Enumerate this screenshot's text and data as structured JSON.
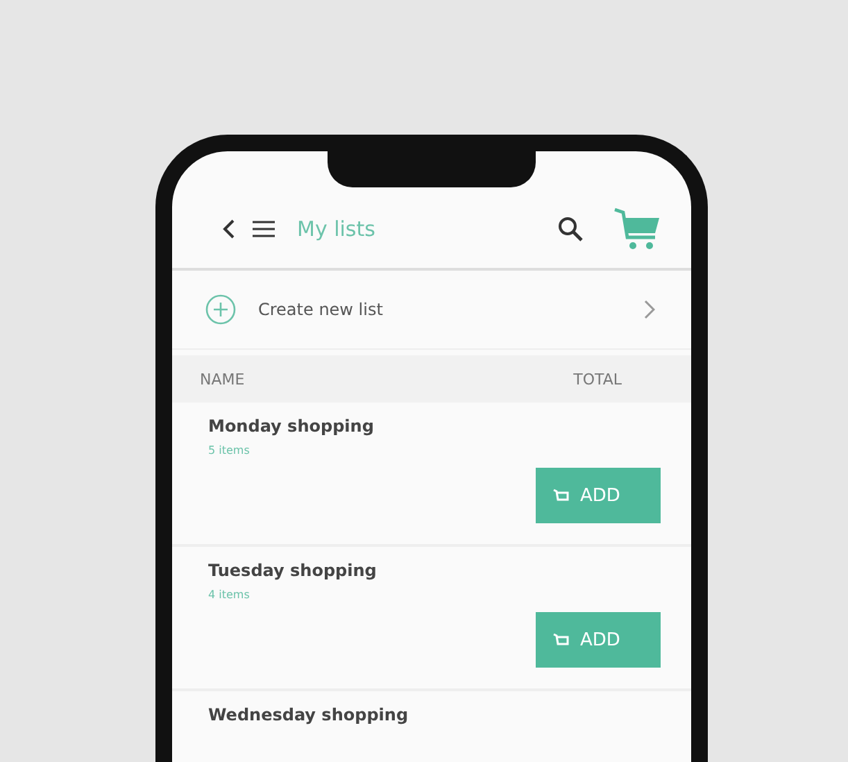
{
  "header": {
    "title": "My lists"
  },
  "create_row": {
    "label": "Create new list"
  },
  "table": {
    "columns": [
      "NAME",
      "TOTAL"
    ],
    "rows": [
      {
        "name": "Monday shopping",
        "count": "5 items",
        "button": "ADD"
      },
      {
        "name": "Tuesday shopping",
        "count": "4 items",
        "button": "ADD"
      },
      {
        "name": "Wednesday shopping"
      }
    ]
  }
}
